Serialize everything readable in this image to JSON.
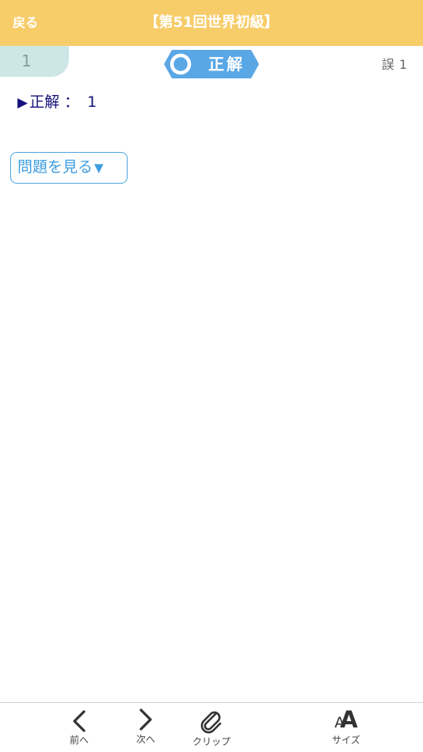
{
  "header": {
    "back_label": "戻る",
    "title": "【第51回世界初級】"
  },
  "question": {
    "number": "1",
    "result_label": "正解",
    "mistake_label": "誤",
    "mistake_count": "1"
  },
  "answer": {
    "marker": "▶",
    "label": "正解",
    "colon": "：",
    "value": "1"
  },
  "view_question": {
    "label": "問題を見る",
    "arrow": "▼"
  },
  "toolbar": {
    "prev_label": "前へ",
    "next_label": "次へ",
    "clip_label": "クリップ",
    "size_label": "サイズ",
    "size_icon_small": "A",
    "size_icon_big": "A"
  },
  "colors": {
    "header_bg": "#f7cd6a",
    "tab_bg": "#cde6e6",
    "badge_blue": "#5aa7e6",
    "answer_text": "#14127a",
    "link_blue": "#3e9de0"
  }
}
